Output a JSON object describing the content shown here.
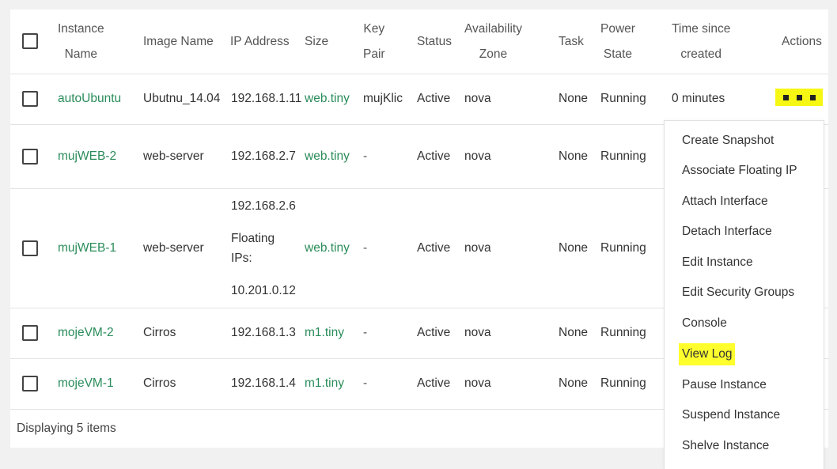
{
  "table": {
    "headers": {
      "instance_name": [
        "Instance",
        "Name"
      ],
      "image_name": "Image Name",
      "ip_address": "IP Address",
      "size": "Size",
      "key_pair": [
        "Key",
        "Pair"
      ],
      "status": "Status",
      "availability_zone": [
        "Availability",
        "Zone"
      ],
      "task": "Task",
      "power_state": [
        "Power",
        "State"
      ],
      "time_since_created": [
        "Time since",
        "created"
      ],
      "actions": "Actions"
    },
    "rows": [
      {
        "name": "autoUbuntu",
        "image": "Ubutnu_14.04",
        "ip": "192.168.1.11",
        "size": "web.tiny",
        "key_pair": "mujKlic",
        "status": "Active",
        "zone": "nova",
        "task": "None",
        "power": "Running",
        "time": "0 minutes"
      },
      {
        "name": "mujWEB-2",
        "image": "web-server",
        "ip": "192.168.2.7",
        "size": "web.tiny",
        "key_pair": "-",
        "status": "Active",
        "zone": "nova",
        "task": "None",
        "power": "Running"
      },
      {
        "name": "mujWEB-1",
        "image": "web-server",
        "ip": "192.168.2.6",
        "floating_label_1": "Floating",
        "floating_label_2": "IPs:",
        "floating_ip": "10.201.0.12",
        "size": "web.tiny",
        "key_pair": "-",
        "status": "Active",
        "zone": "nova",
        "task": "None",
        "power": "Running"
      },
      {
        "name": "mojeVM-2",
        "image": "Cirros",
        "ip": "192.168.1.3",
        "size": "m1.tiny",
        "key_pair": "-",
        "status": "Active",
        "zone": "nova",
        "task": "None",
        "power": "Running"
      },
      {
        "name": "mojeVM-1",
        "image": "Cirros",
        "ip": "192.168.1.4",
        "size": "m1.tiny",
        "key_pair": "-",
        "status": "Active",
        "zone": "nova",
        "task": "None",
        "power": "Running"
      }
    ],
    "footer": "Displaying 5 items"
  },
  "actions_menu": {
    "items": [
      "Create Snapshot",
      "Associate Floating IP",
      "Attach Interface",
      "Detach Interface",
      "Edit Instance",
      "Edit Security Groups",
      "Console",
      "View Log",
      "Pause Instance",
      "Suspend Instance",
      "Shelve Instance"
    ],
    "highlighted": "View Log"
  },
  "colors": {
    "link": "#2a8c5a",
    "highlight": "#ffff2d"
  }
}
